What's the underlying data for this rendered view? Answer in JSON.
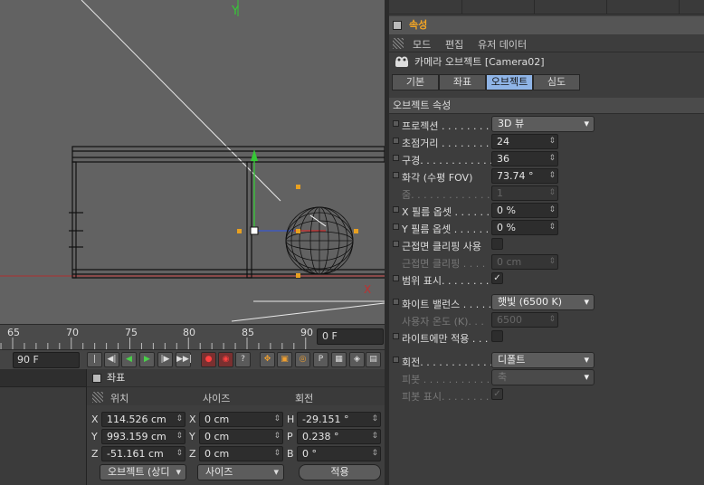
{
  "viewport": {
    "axis_y_label": "Y",
    "axis_x_label": "X"
  },
  "timeline": {
    "ticks": [
      "65",
      "70",
      "75",
      "80",
      "85",
      "90"
    ],
    "current_frame": "0 F"
  },
  "toolbar": {
    "end_frame": "90 F",
    "buttons": [
      {
        "name": "goto-start-button",
        "glyph": "|◀◀"
      },
      {
        "name": "prev-key-button",
        "glyph": "◀|"
      },
      {
        "name": "play-back-button",
        "glyph": "◀"
      },
      {
        "name": "play-button",
        "glyph": "▶"
      },
      {
        "name": "next-key-button",
        "glyph": "|▶"
      },
      {
        "name": "goto-end-button",
        "glyph": "▶▶|"
      },
      {
        "name": "record-button",
        "glyph": "●"
      },
      {
        "name": "autokey-button",
        "glyph": "◉"
      },
      {
        "name": "keyframe-select-button",
        "glyph": "?"
      },
      {
        "name": "move-key-button",
        "glyph": "✥"
      },
      {
        "name": "scale-key-button",
        "glyph": "▣"
      },
      {
        "name": "rotate-key-button",
        "glyph": "◎"
      },
      {
        "name": "param-key-button",
        "glyph": "P"
      },
      {
        "name": "pla-key-button",
        "glyph": "▦"
      },
      {
        "name": "sound-key-button",
        "glyph": "◈"
      },
      {
        "name": "scheme-button",
        "glyph": "▤"
      }
    ]
  },
  "coords": {
    "title": "좌표",
    "col_position": "위치",
    "col_size": "사이즈",
    "col_rotation": "회전",
    "rows": [
      {
        "pos_axis": "X",
        "pos": "114.526 cm",
        "size_axis": "X",
        "size": "0 cm",
        "rot_axis": "H",
        "rot": "-29.151 °"
      },
      {
        "pos_axis": "Y",
        "pos": "993.159 cm",
        "size_axis": "Y",
        "size": "0 cm",
        "rot_axis": "P",
        "rot": "0.238 °"
      },
      {
        "pos_axis": "Z",
        "pos": "-51.161 cm",
        "size_axis": "Z",
        "size": "0 cm",
        "rot_axis": "B",
        "rot": "0 °"
      }
    ],
    "mode_dropdown": "오브젝트 (상디",
    "size_dropdown": "사이즈",
    "apply_button": "적용"
  },
  "attributes": {
    "title": "속성",
    "menu": [
      "모드",
      "편집",
      "유저 데이터"
    ],
    "object_name": "카메라 오브젝트 [Camera02]",
    "tabs": [
      {
        "label": "기본",
        "active": false
      },
      {
        "label": "좌표",
        "active": false
      },
      {
        "label": "오브젝트",
        "active": true
      },
      {
        "label": "심도",
        "active": false
      }
    ],
    "section": "오브젝트 속성",
    "props": [
      {
        "label": "프로젝션 . . . . . . . . .",
        "value": "3D 뷰",
        "kind": "dropdown"
      },
      {
        "label": "초점거리 . . . . . . . . .",
        "value": "24",
        "kind": "field"
      },
      {
        "label": "구경. . . . . . . . . . . . .",
        "value": "36",
        "kind": "field"
      },
      {
        "label": "화각 (수평 FOV)",
        "value": "73.74 °",
        "kind": "field"
      },
      {
        "label": "줌. . . . . . . . . . . . . . .",
        "value": "1",
        "kind": "field-dim"
      },
      {
        "label": "X 필름 옵셋 . . . . . . .",
        "value": "0 %",
        "kind": "field"
      },
      {
        "label": "Y 필름 옵셋 . . . . . . .",
        "value": "0 %",
        "kind": "field"
      },
      {
        "label": "근접면 클리핑 사용",
        "value": "",
        "kind": "check"
      },
      {
        "label": "근접면 클리핑 . . . .",
        "value": "0 cm",
        "kind": "field-dim"
      },
      {
        "label": "범위 표시. . . . . . . . .",
        "value": "✓",
        "kind": "check"
      },
      {
        "label": "화이트 밸런스 . . . . .",
        "value": "햇빛 (6500 K)",
        "kind": "dropdown"
      },
      {
        "label": "사용자 온도 (K). . .",
        "value": "6500",
        "kind": "field-dim"
      },
      {
        "label": "라이트에만 적용 . . .",
        "value": "",
        "kind": "check"
      },
      {
        "label": "회전. . . . . . . . . . . . .",
        "value": "디폴트",
        "kind": "dropdown"
      },
      {
        "label": "피봇 . . . . . . . . . . . .",
        "value": "축",
        "kind": "dropdown-dim"
      },
      {
        "label": "피봇 표시. . . . . . . . .",
        "value": "✓",
        "kind": "check-dim"
      }
    ]
  }
}
